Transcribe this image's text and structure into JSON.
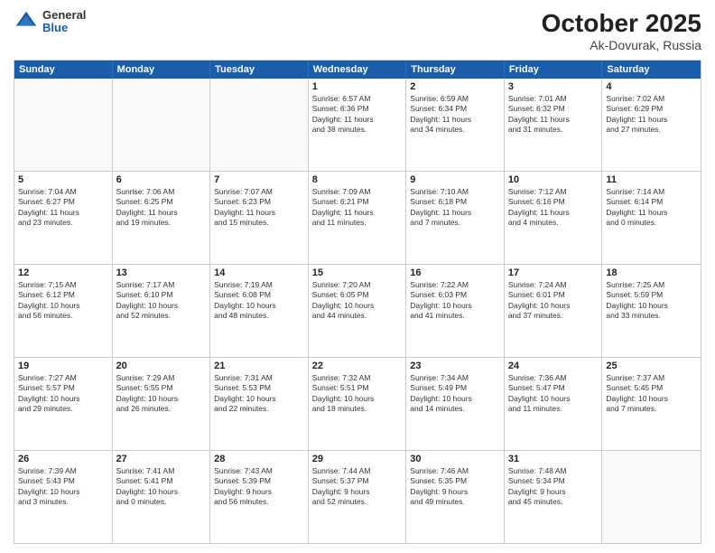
{
  "header": {
    "logo": {
      "general": "General",
      "blue": "Blue"
    },
    "title": "October 2025",
    "location": "Ak-Dovurak, Russia"
  },
  "days_of_week": [
    "Sunday",
    "Monday",
    "Tuesday",
    "Wednesday",
    "Thursday",
    "Friday",
    "Saturday"
  ],
  "weeks": [
    [
      {
        "day": "",
        "text": ""
      },
      {
        "day": "",
        "text": ""
      },
      {
        "day": "",
        "text": ""
      },
      {
        "day": "1",
        "text": "Sunrise: 6:57 AM\nSunset: 6:36 PM\nDaylight: 11 hours\nand 38 minutes."
      },
      {
        "day": "2",
        "text": "Sunrise: 6:59 AM\nSunset: 6:34 PM\nDaylight: 11 hours\nand 34 minutes."
      },
      {
        "day": "3",
        "text": "Sunrise: 7:01 AM\nSunset: 6:32 PM\nDaylight: 11 hours\nand 31 minutes."
      },
      {
        "day": "4",
        "text": "Sunrise: 7:02 AM\nSunset: 6:29 PM\nDaylight: 11 hours\nand 27 minutes."
      }
    ],
    [
      {
        "day": "5",
        "text": "Sunrise: 7:04 AM\nSunset: 6:27 PM\nDaylight: 11 hours\nand 23 minutes."
      },
      {
        "day": "6",
        "text": "Sunrise: 7:06 AM\nSunset: 6:25 PM\nDaylight: 11 hours\nand 19 minutes."
      },
      {
        "day": "7",
        "text": "Sunrise: 7:07 AM\nSunset: 6:23 PM\nDaylight: 11 hours\nand 15 minutes."
      },
      {
        "day": "8",
        "text": "Sunrise: 7:09 AM\nSunset: 6:21 PM\nDaylight: 11 hours\nand 11 minutes."
      },
      {
        "day": "9",
        "text": "Sunrise: 7:10 AM\nSunset: 6:18 PM\nDaylight: 11 hours\nand 7 minutes."
      },
      {
        "day": "10",
        "text": "Sunrise: 7:12 AM\nSunset: 6:16 PM\nDaylight: 11 hours\nand 4 minutes."
      },
      {
        "day": "11",
        "text": "Sunrise: 7:14 AM\nSunset: 6:14 PM\nDaylight: 11 hours\nand 0 minutes."
      }
    ],
    [
      {
        "day": "12",
        "text": "Sunrise: 7:15 AM\nSunset: 6:12 PM\nDaylight: 10 hours\nand 56 minutes."
      },
      {
        "day": "13",
        "text": "Sunrise: 7:17 AM\nSunset: 6:10 PM\nDaylight: 10 hours\nand 52 minutes."
      },
      {
        "day": "14",
        "text": "Sunrise: 7:19 AM\nSunset: 6:08 PM\nDaylight: 10 hours\nand 48 minutes."
      },
      {
        "day": "15",
        "text": "Sunrise: 7:20 AM\nSunset: 6:05 PM\nDaylight: 10 hours\nand 44 minutes."
      },
      {
        "day": "16",
        "text": "Sunrise: 7:22 AM\nSunset: 6:03 PM\nDaylight: 10 hours\nand 41 minutes."
      },
      {
        "day": "17",
        "text": "Sunrise: 7:24 AM\nSunset: 6:01 PM\nDaylight: 10 hours\nand 37 minutes."
      },
      {
        "day": "18",
        "text": "Sunrise: 7:25 AM\nSunset: 5:59 PM\nDaylight: 10 hours\nand 33 minutes."
      }
    ],
    [
      {
        "day": "19",
        "text": "Sunrise: 7:27 AM\nSunset: 5:57 PM\nDaylight: 10 hours\nand 29 minutes."
      },
      {
        "day": "20",
        "text": "Sunrise: 7:29 AM\nSunset: 5:55 PM\nDaylight: 10 hours\nand 26 minutes."
      },
      {
        "day": "21",
        "text": "Sunrise: 7:31 AM\nSunset: 5:53 PM\nDaylight: 10 hours\nand 22 minutes."
      },
      {
        "day": "22",
        "text": "Sunrise: 7:32 AM\nSunset: 5:51 PM\nDaylight: 10 hours\nand 18 minutes."
      },
      {
        "day": "23",
        "text": "Sunrise: 7:34 AM\nSunset: 5:49 PM\nDaylight: 10 hours\nand 14 minutes."
      },
      {
        "day": "24",
        "text": "Sunrise: 7:36 AM\nSunset: 5:47 PM\nDaylight: 10 hours\nand 11 minutes."
      },
      {
        "day": "25",
        "text": "Sunrise: 7:37 AM\nSunset: 5:45 PM\nDaylight: 10 hours\nand 7 minutes."
      }
    ],
    [
      {
        "day": "26",
        "text": "Sunrise: 7:39 AM\nSunset: 5:43 PM\nDaylight: 10 hours\nand 3 minutes."
      },
      {
        "day": "27",
        "text": "Sunrise: 7:41 AM\nSunset: 5:41 PM\nDaylight: 10 hours\nand 0 minutes."
      },
      {
        "day": "28",
        "text": "Sunrise: 7:43 AM\nSunset: 5:39 PM\nDaylight: 9 hours\nand 56 minutes."
      },
      {
        "day": "29",
        "text": "Sunrise: 7:44 AM\nSunset: 5:37 PM\nDaylight: 9 hours\nand 52 minutes."
      },
      {
        "day": "30",
        "text": "Sunrise: 7:46 AM\nSunset: 5:35 PM\nDaylight: 9 hours\nand 49 minutes."
      },
      {
        "day": "31",
        "text": "Sunrise: 7:48 AM\nSunset: 5:34 PM\nDaylight: 9 hours\nand 45 minutes."
      },
      {
        "day": "",
        "text": ""
      }
    ]
  ]
}
